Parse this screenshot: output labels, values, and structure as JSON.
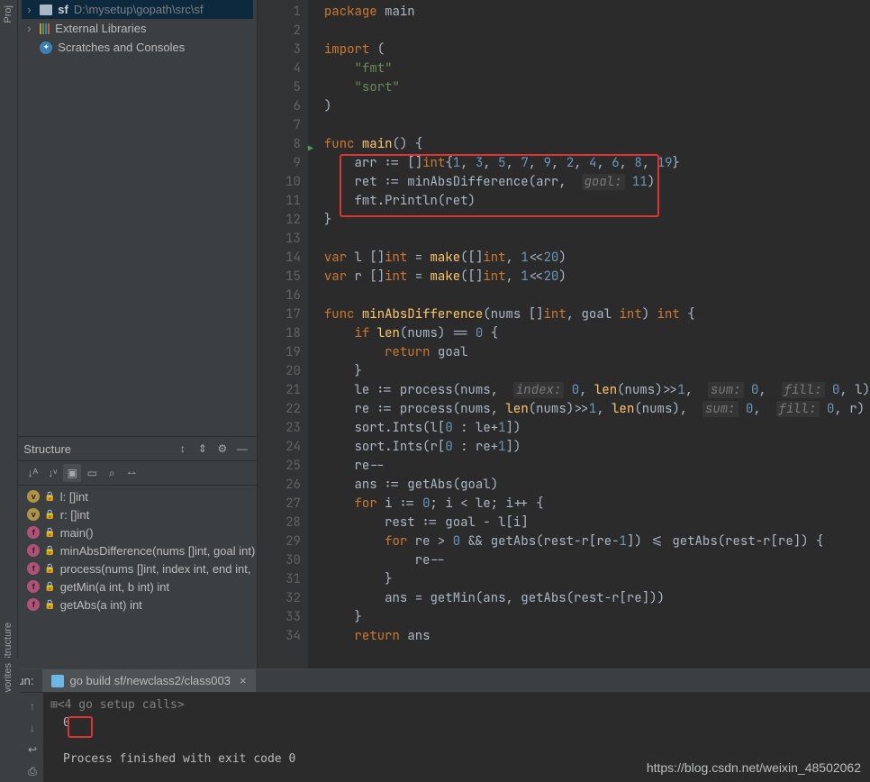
{
  "sidebar": {
    "proj_rail": "Proj",
    "structure_rail": "Structure",
    "favorites_rail": "vorites",
    "tree": {
      "root_label": "sf",
      "root_path": "D:\\mysetup\\gopath\\src\\sf",
      "ext_lib": "External Libraries",
      "scratches": "Scratches and Consoles"
    }
  },
  "structure": {
    "title": "Structure",
    "items": [
      {
        "kind": "v",
        "label": "l: []int"
      },
      {
        "kind": "v",
        "label": "r: []int"
      },
      {
        "kind": "f",
        "label": "main()"
      },
      {
        "kind": "f",
        "label": "minAbsDifference(nums []int, goal int)"
      },
      {
        "kind": "f",
        "label": "process(nums []int, index int, end int,"
      },
      {
        "kind": "f",
        "label": "getMin(a int, b int) int"
      },
      {
        "kind": "f",
        "label": "getAbs(a int) int"
      }
    ]
  },
  "editor": {
    "lines": [
      {
        "n": 1,
        "t": "package main",
        "seg": [
          [
            "kw",
            "package "
          ],
          [
            "id",
            "main"
          ]
        ]
      },
      {
        "n": 2,
        "t": ""
      },
      {
        "n": 3,
        "t": "import (",
        "seg": [
          [
            "kw",
            "import "
          ],
          [
            "id",
            "("
          ]
        ]
      },
      {
        "n": 4,
        "t": "    \"fmt\"",
        "seg": [
          [
            "id",
            "    "
          ],
          [
            "str",
            "\"fmt\""
          ]
        ]
      },
      {
        "n": 5,
        "t": "    \"sort\"",
        "seg": [
          [
            "id",
            "    "
          ],
          [
            "str",
            "\"sort\""
          ]
        ]
      },
      {
        "n": 6,
        "t": ")",
        "seg": [
          [
            "id",
            ")"
          ]
        ]
      },
      {
        "n": 7,
        "t": ""
      },
      {
        "n": 8,
        "run": true,
        "seg": [
          [
            "kw",
            "func "
          ],
          [
            "fnn",
            "main"
          ],
          [
            "id",
            "() {"
          ]
        ]
      },
      {
        "n": 9,
        "seg": [
          [
            "id",
            "    arr := []"
          ],
          [
            "kw",
            "int"
          ],
          [
            "id",
            "{"
          ],
          [
            "num",
            "1"
          ],
          [
            "id",
            ", "
          ],
          [
            "num",
            "3"
          ],
          [
            "id",
            ", "
          ],
          [
            "num",
            "5"
          ],
          [
            "id",
            ", "
          ],
          [
            "num",
            "7"
          ],
          [
            "id",
            ", "
          ],
          [
            "num",
            "9"
          ],
          [
            "id",
            ", "
          ],
          [
            "num",
            "2"
          ],
          [
            "id",
            ", "
          ],
          [
            "num",
            "4"
          ],
          [
            "id",
            ", "
          ],
          [
            "num",
            "6"
          ],
          [
            "id",
            ", "
          ],
          [
            "num",
            "8"
          ],
          [
            "id",
            ", "
          ],
          [
            "num",
            "19"
          ],
          [
            "id",
            "}"
          ]
        ]
      },
      {
        "n": 10,
        "seg": [
          [
            "id",
            "    ret := minAbsDifference(arr,  "
          ],
          [
            "hint",
            "goal:"
          ],
          [
            "id",
            " "
          ],
          [
            "num",
            "11"
          ],
          [
            "id",
            ")"
          ]
        ]
      },
      {
        "n": 11,
        "seg": [
          [
            "id",
            "    fmt.Println(ret)"
          ]
        ]
      },
      {
        "n": 12,
        "seg": [
          [
            "id",
            "}"
          ]
        ]
      },
      {
        "n": 13,
        "t": ""
      },
      {
        "n": 14,
        "seg": [
          [
            "kw",
            "var "
          ],
          [
            "id",
            "l []"
          ],
          [
            "kw",
            "int"
          ],
          [
            "id",
            " = "
          ],
          [
            "fnn",
            "make"
          ],
          [
            "id",
            "([]"
          ],
          [
            "kw",
            "int"
          ],
          [
            "id",
            ", "
          ],
          [
            "num",
            "1"
          ],
          [
            "id",
            "<<"
          ],
          [
            "num",
            "20"
          ],
          [
            "id",
            ")"
          ]
        ]
      },
      {
        "n": 15,
        "seg": [
          [
            "kw",
            "var "
          ],
          [
            "id",
            "r []"
          ],
          [
            "kw",
            "int"
          ],
          [
            "id",
            " = "
          ],
          [
            "fnn",
            "make"
          ],
          [
            "id",
            "([]"
          ],
          [
            "kw",
            "int"
          ],
          [
            "id",
            ", "
          ],
          [
            "num",
            "1"
          ],
          [
            "id",
            "<<"
          ],
          [
            "num",
            "20"
          ],
          [
            "id",
            ")"
          ]
        ]
      },
      {
        "n": 16,
        "t": ""
      },
      {
        "n": 17,
        "seg": [
          [
            "kw",
            "func "
          ],
          [
            "fnn",
            "minAbsDifference"
          ],
          [
            "id",
            "(nums []"
          ],
          [
            "kw",
            "int"
          ],
          [
            "id",
            ", goal "
          ],
          [
            "kw",
            "int"
          ],
          [
            "id",
            ") "
          ],
          [
            "kw",
            "int"
          ],
          [
            "id",
            " {"
          ]
        ]
      },
      {
        "n": 18,
        "seg": [
          [
            "id",
            "    "
          ],
          [
            "kw",
            "if "
          ],
          [
            "fnn",
            "len"
          ],
          [
            "id",
            "(nums) == "
          ],
          [
            "num",
            "0"
          ],
          [
            "id",
            " {"
          ]
        ]
      },
      {
        "n": 19,
        "seg": [
          [
            "id",
            "        "
          ],
          [
            "kw",
            "return "
          ],
          [
            "id",
            "goal"
          ]
        ]
      },
      {
        "n": 20,
        "seg": [
          [
            "id",
            "    }"
          ]
        ]
      },
      {
        "n": 21,
        "seg": [
          [
            "id",
            "    le := process(nums,  "
          ],
          [
            "hint",
            "index:"
          ],
          [
            "id",
            " "
          ],
          [
            "num",
            "0"
          ],
          [
            "id",
            ", "
          ],
          [
            "fnn",
            "len"
          ],
          [
            "id",
            "(nums)>>"
          ],
          [
            "num",
            "1"
          ],
          [
            "id",
            ",  "
          ],
          [
            "hint",
            "sum:"
          ],
          [
            "id",
            " "
          ],
          [
            "num",
            "0"
          ],
          [
            "id",
            ",  "
          ],
          [
            "hint",
            "fill:"
          ],
          [
            "id",
            " "
          ],
          [
            "num",
            "0"
          ],
          [
            "id",
            ", l)"
          ]
        ]
      },
      {
        "n": 22,
        "seg": [
          [
            "id",
            "    re := process(nums, "
          ],
          [
            "fnn",
            "len"
          ],
          [
            "id",
            "(nums)>>"
          ],
          [
            "num",
            "1"
          ],
          [
            "id",
            ", "
          ],
          [
            "fnn",
            "len"
          ],
          [
            "id",
            "(nums),  "
          ],
          [
            "hint",
            "sum:"
          ],
          [
            "id",
            " "
          ],
          [
            "num",
            "0"
          ],
          [
            "id",
            ",  "
          ],
          [
            "hint",
            "fill:"
          ],
          [
            "id",
            " "
          ],
          [
            "num",
            "0"
          ],
          [
            "id",
            ", r)"
          ]
        ]
      },
      {
        "n": 23,
        "seg": [
          [
            "id",
            "    sort.Ints(l["
          ],
          [
            "num",
            "0"
          ],
          [
            "id",
            " : le+"
          ],
          [
            "num",
            "1"
          ],
          [
            "id",
            "])"
          ]
        ]
      },
      {
        "n": 24,
        "seg": [
          [
            "id",
            "    sort.Ints(r["
          ],
          [
            "num",
            "0"
          ],
          [
            "id",
            " : re+"
          ],
          [
            "num",
            "1"
          ],
          [
            "id",
            "])"
          ]
        ]
      },
      {
        "n": 25,
        "seg": [
          [
            "id",
            "    re--"
          ]
        ]
      },
      {
        "n": 26,
        "seg": [
          [
            "id",
            "    ans := getAbs(goal)"
          ]
        ]
      },
      {
        "n": 27,
        "seg": [
          [
            "id",
            "    "
          ],
          [
            "kw",
            "for "
          ],
          [
            "id",
            "i := "
          ],
          [
            "num",
            "0"
          ],
          [
            "id",
            "; i < le; i++ {"
          ]
        ]
      },
      {
        "n": 28,
        "seg": [
          [
            "id",
            "        rest := goal - l[i]"
          ]
        ]
      },
      {
        "n": 29,
        "seg": [
          [
            "id",
            "        "
          ],
          [
            "kw",
            "for "
          ],
          [
            "id",
            "re > "
          ],
          [
            "num",
            "0"
          ],
          [
            "id",
            " && getAbs(rest-r[re-"
          ],
          [
            "num",
            "1"
          ],
          [
            "id",
            "]) <= getAbs(rest-r[re]) {"
          ]
        ]
      },
      {
        "n": 30,
        "seg": [
          [
            "id",
            "            re--"
          ]
        ]
      },
      {
        "n": 31,
        "seg": [
          [
            "id",
            "        }"
          ]
        ]
      },
      {
        "n": 32,
        "seg": [
          [
            "id",
            "        ans = getMin(ans, getAbs(rest-r[re]))"
          ]
        ]
      },
      {
        "n": 33,
        "seg": [
          [
            "id",
            "    }"
          ]
        ]
      },
      {
        "n": 34,
        "seg": [
          [
            "id",
            "    "
          ],
          [
            "kw",
            "return "
          ],
          [
            "id",
            "ans"
          ]
        ]
      }
    ]
  },
  "run": {
    "title": "Run:",
    "tab": "go build sf/newclass2/class003",
    "fold": "<4 go setup calls>",
    "output": "0",
    "exit": "Process finished with exit code 0"
  },
  "watermark": "https://blog.csdn.net/weixin_48502062"
}
